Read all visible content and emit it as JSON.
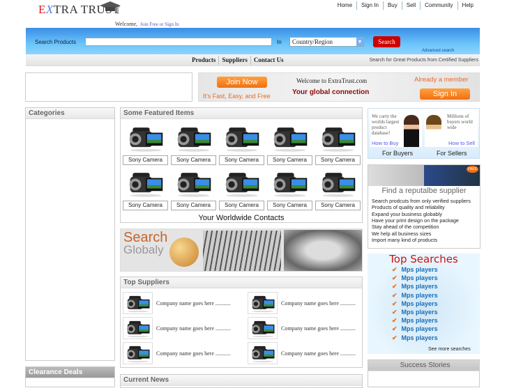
{
  "logo": {
    "text_e": "E",
    "text_x": "X",
    "text_rest": "TRA TRUST"
  },
  "welcome": {
    "text": "Welcome,",
    "link": "Join Free or Sign In"
  },
  "top_nav": [
    "Home",
    "Sign In",
    "Buy",
    "Sell",
    "Community",
    "Help"
  ],
  "search": {
    "label": "Search Products",
    "value": "",
    "in_label": "In",
    "country": "Country/Region",
    "button": "Search",
    "advanced": "Advanced search"
  },
  "menu": {
    "items": [
      "Products",
      "Suppliers",
      "Contact Us"
    ],
    "tagline": "Search for Great Products from Certified Suppliers"
  },
  "join_banner": {
    "join": "Join Now",
    "fast": "It's Fast, Easy, and Free",
    "welcome": "Welcome to ExtraTrust.com",
    "global": "Your global connection",
    "member": "Already a member",
    "signin": "Sign In"
  },
  "categories": {
    "title": "Categories"
  },
  "clearance": {
    "title": "Clearance Deals"
  },
  "featured": {
    "title": "Some Featured Items",
    "items": [
      "Sony Camera",
      "Sony Camera",
      "Sony Camera",
      "Sony Camera",
      "Sony Camera",
      "Sony Camera",
      "Sony Camera",
      "Sony Camera",
      "Sony Camera",
      "Sony Camera"
    ],
    "contacts": "Your Worldwide Contacts"
  },
  "search_globaly": {
    "line1": "Search",
    "line2": "Globaly"
  },
  "top_suppliers": {
    "title": "Top Suppliers",
    "items": [
      "Company name goes here ...........",
      "Company name goes here ...........",
      "Company name goes here ...........",
      "Company name goes here ...........",
      "Company name goes here ...........",
      "Company name goes here ..........."
    ]
  },
  "news": {
    "title": "Current News"
  },
  "buyers": {
    "buyer_text": "We carry the worlds largest product database!",
    "how_buy": "How to Buy",
    "for_buyers": "For Buyers",
    "seller_text": "Millions of buyers world wide",
    "how_sell": "How to Sell",
    "for_sellers": "For Sellers"
  },
  "supplier_box": {
    "badge": "FREE",
    "title": "Find a reputalbe supplier",
    "lines": [
      "Search prodcuts from only verified suppliers",
      "Products of quality and reliability",
      "Expand your business globably",
      "Have your print design on the package",
      "Stay ahead of the competition",
      "We help all business sizes",
      "Import many kind of products"
    ]
  },
  "top_searches": {
    "title": "Top Searches",
    "items": [
      "Mps players",
      "Mps players",
      "Mps players",
      "Mps players",
      "Mps players",
      "Mps players",
      "Mps players",
      "Mps players",
      "Mps players"
    ],
    "more": "See more searches"
  },
  "success": {
    "title": "Success Stories"
  }
}
